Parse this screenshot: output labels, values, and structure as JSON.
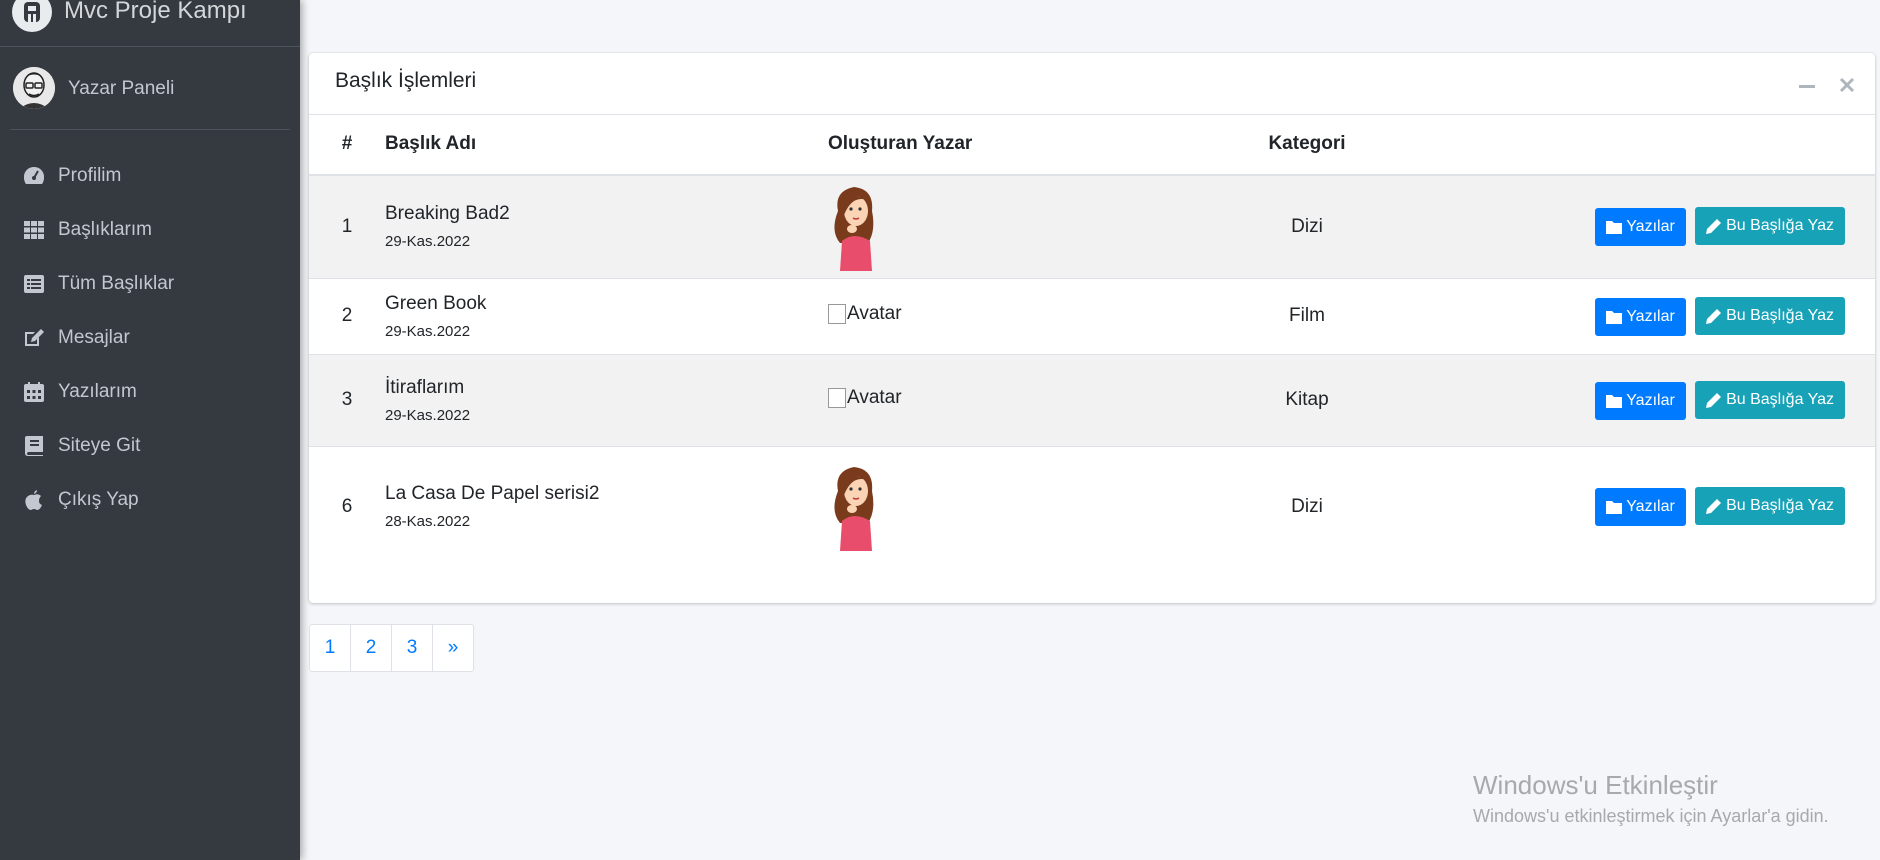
{
  "sidebar": {
    "brand": "Mvc Proje Kampı",
    "user_name": "Yazar Paneli",
    "items": [
      {
        "label": "Profilim",
        "icon": "tachometer-icon"
      },
      {
        "label": "Başlıklarım",
        "icon": "th-grid-icon"
      },
      {
        "label": "Tüm Başlıklar",
        "icon": "list-alt-icon"
      },
      {
        "label": "Mesajlar",
        "icon": "edit-icon"
      },
      {
        "label": "Yazılarım",
        "icon": "calendar-icon"
      },
      {
        "label": "Siteye Git",
        "icon": "book-icon"
      },
      {
        "label": "Çıkış Yap",
        "icon": "apple-icon"
      }
    ]
  },
  "card": {
    "title": "Başlık İşlemleri",
    "columns": [
      "#",
      "Başlık Adı",
      "Oluşturan Yazar",
      "Kategori"
    ],
    "rows": [
      {
        "num": "1",
        "title": "Breaking Bad2",
        "date": "29-Kas.2022",
        "author_avatar": "woman-cartoon",
        "category": "Dizi"
      },
      {
        "num": "2",
        "title": "Green Book",
        "date": "29-Kas.2022",
        "author_avatar": "broken",
        "avatar_alt": "Avatar",
        "category": "Film"
      },
      {
        "num": "3",
        "title": "İtiraflarım",
        "date": "29-Kas.2022",
        "author_avatar": "broken",
        "avatar_alt": "Avatar",
        "category": "Kitap"
      },
      {
        "num": "6",
        "title": "La Casa De Papel serisi2",
        "date": "28-Kas.2022",
        "author_avatar": "woman-cartoon",
        "category": "Dizi"
      }
    ],
    "btn_posts": "Yazılar",
    "btn_write": "Bu Başlığa Yaz"
  },
  "pagination": [
    "1",
    "2",
    "3",
    "»"
  ],
  "watermark": {
    "title": "Windows'u Etkinleştir",
    "subtitle": "Windows'u etkinleştirmek için Ayarlar'a gidin."
  },
  "colors": {
    "sidebar_bg": "#343a40",
    "primary": "#007bff",
    "info": "#17a2b8"
  }
}
